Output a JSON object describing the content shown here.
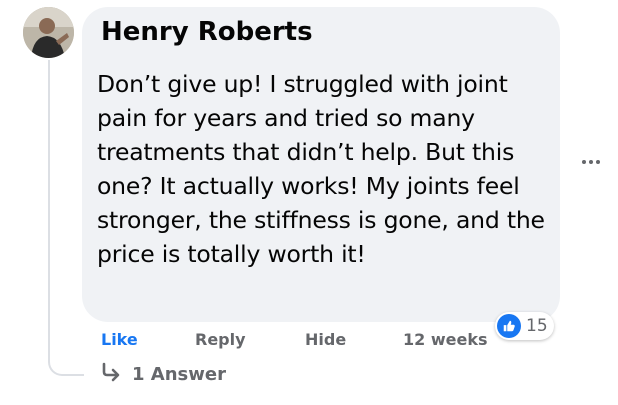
{
  "comment": {
    "author": "Henry Roberts",
    "text": "Don’t give up! I struggled with joint pain for years and tried so many treatments that didn’t help. But this one? It actually works! My joints feel stronger, the stiffness is gone, and the price is totally worth it!",
    "timestamp": "12 weeks",
    "reaction_count": "15",
    "reaction_icon": "thumbs-up-icon"
  },
  "actions": {
    "like_label": "Like",
    "reply_label": "Reply",
    "hide_label": "Hide"
  },
  "answers": {
    "label": "1 Answer"
  },
  "colors": {
    "accent": "#1877f2",
    "bubble": "#f0f2f5",
    "muted_text": "#65676b"
  }
}
